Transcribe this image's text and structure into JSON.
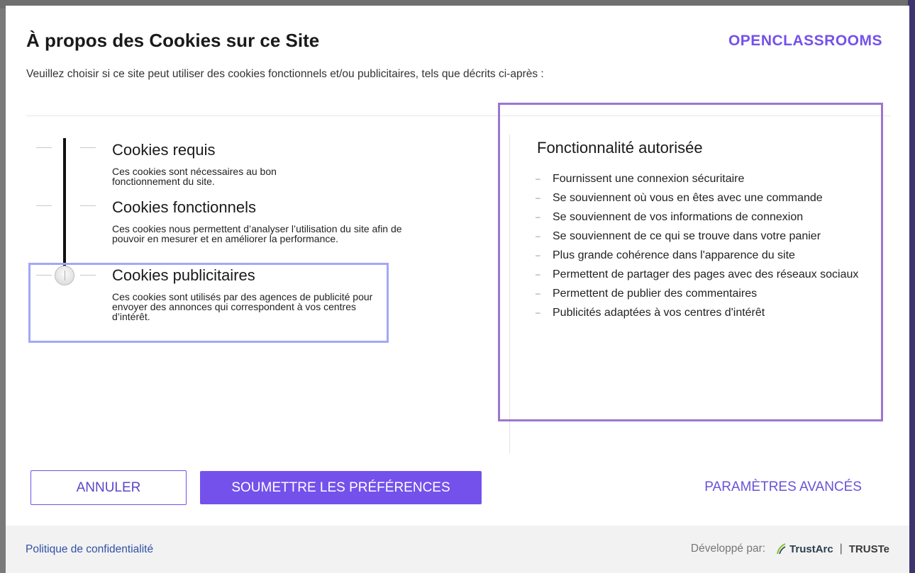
{
  "dialog": {
    "title": "À propos des Cookies sur ce Site",
    "brand": "OPENCLASSROOMS",
    "subtitle": "Veuillez choisir si ce site peut utiliser des cookies fonctionnels et/ou publicitaires, tels que décrits ci-après :"
  },
  "options": [
    {
      "title": "Cookies requis",
      "desc": "Ces cookies sont nécessaires au bon fonctionnement du site."
    },
    {
      "title": "Cookies fonctionnels",
      "desc": "Ces cookies nous permettent d’analyser l’utilisation du site afin de pouvoir en mesurer et en améliorer la performance."
    },
    {
      "title": "Cookies publicitaires",
      "desc": "Ces cookies sont utilisés par des agences de publicité pour envoyer des annonces qui correspondent à vos centres d’intérêt."
    }
  ],
  "slider": {
    "selected_level": 3,
    "levels": 3
  },
  "features": {
    "title": "Fonctionnalité autorisée",
    "items": [
      "Fournissent une connexion sécuritaire",
      "Se souviennent où vous en êtes avec une commande",
      "Se souviennent de vos informations de connexion",
      "Se souviennent de ce qui se trouve dans votre panier",
      "Plus grande cohérence dans l'apparence du site",
      "Permettent de partager des pages avec des réseaux sociaux",
      "Permettent de publier des commentaires",
      "Publicités adaptées à vos centres d'intérêt"
    ]
  },
  "actions": {
    "cancel": "ANNULER",
    "submit": "SOUMETTRE LES PRÉFÉRENCES",
    "advanced": "PARAMÈTRES AVANCÉS"
  },
  "footer": {
    "privacy": "Politique de confidentialité",
    "powered_by": "Développé par:",
    "trustarc": "TrustArc",
    "separator": "|",
    "truste": "TRUSTe"
  },
  "colors": {
    "accent": "#7451eb",
    "highlight_left": "#a3a8f5",
    "highlight_right": "#9b76cf",
    "link": "#3151a6"
  }
}
